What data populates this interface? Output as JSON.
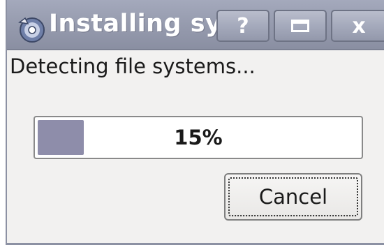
{
  "window": {
    "title": "Installing sy",
    "icon": "installer-disc-icon",
    "controls": {
      "help_label": "?",
      "maximize_icon": "maximize-icon",
      "close_label": "x"
    }
  },
  "status": {
    "message": "Detecting file systems..."
  },
  "progress": {
    "value": 0.15,
    "label": "15%",
    "fill_color": "#8e8daa"
  },
  "actions": {
    "cancel_label": "Cancel"
  },
  "colors": {
    "titlebar": "#969bae",
    "window_bg": "#f2f1f0"
  }
}
